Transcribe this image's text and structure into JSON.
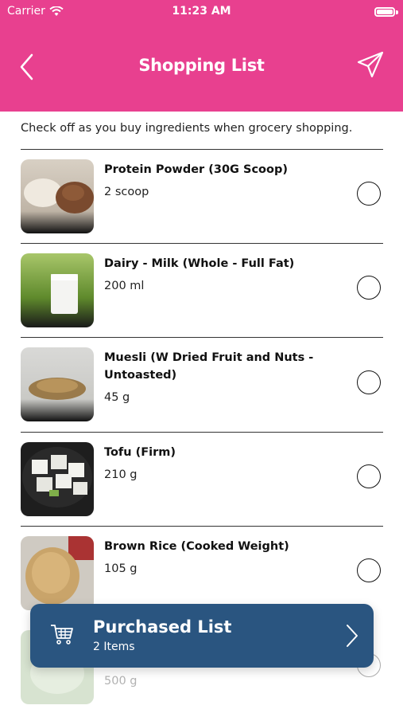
{
  "status_bar": {
    "carrier": "Carrier",
    "time": "11:23 AM"
  },
  "header": {
    "title": "Shopping List"
  },
  "intro": "Check off as you buy ingredients when grocery shopping.",
  "items": [
    {
      "name": "Protein Powder (30G Scoop)",
      "qty": "2 scoop"
    },
    {
      "name": "Dairy - Milk (Whole - Full Fat)",
      "qty": "200 ml"
    },
    {
      "name": "Muesli (W Dried Fruit and Nuts - Untoasted)",
      "qty": "45 g"
    },
    {
      "name": "Tofu (Firm)",
      "qty": "210 g"
    },
    {
      "name": "Brown Rice (Cooked Weight)",
      "qty": "105 g"
    },
    {
      "name": "",
      "qty": "500 g"
    }
  ],
  "purchased": {
    "title": "Purchased List",
    "count": "2 Items"
  },
  "colors": {
    "header": "#E8408F",
    "purchased_bar": "#2A5580"
  }
}
